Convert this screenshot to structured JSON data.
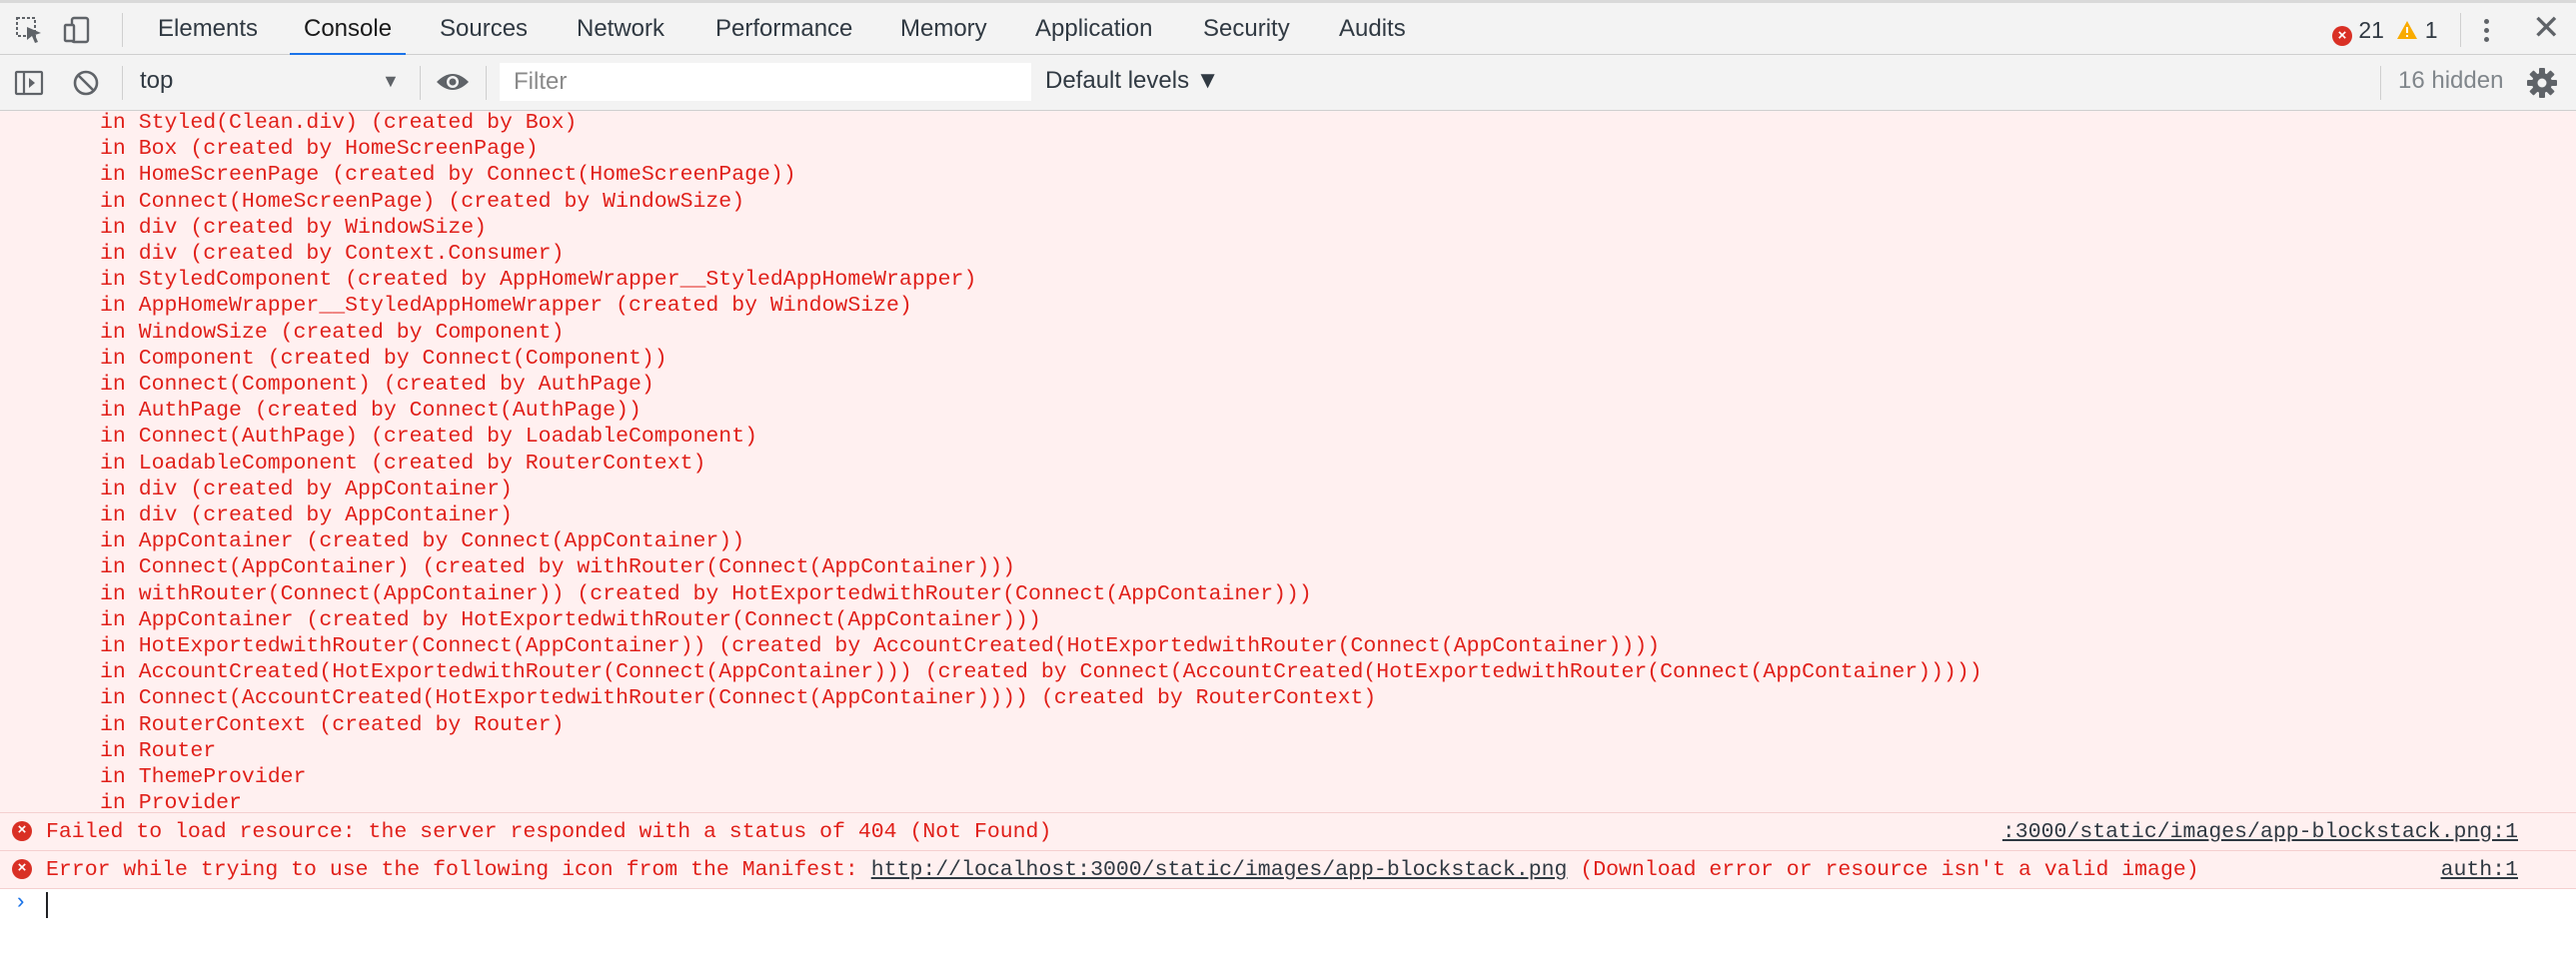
{
  "tabs": [
    "Elements",
    "Console",
    "Sources",
    "Network",
    "Performance",
    "Memory",
    "Application",
    "Security",
    "Audits"
  ],
  "active_tab": "Console",
  "counters": {
    "errors": "21",
    "warnings": "1"
  },
  "toolbar": {
    "context": "top",
    "filter_placeholder": "Filter",
    "levels": "Default levels ▼",
    "hidden": "16 hidden"
  },
  "stack_lines": [
    "in Styled(Clean.div) (created by Box)",
    "in Box (created by HomeScreenPage)",
    "in HomeScreenPage (created by Connect(HomeScreenPage))",
    "in Connect(HomeScreenPage) (created by WindowSize)",
    "in div (created by WindowSize)",
    "in div (created by Context.Consumer)",
    "in StyledComponent (created by AppHomeWrapper__StyledAppHomeWrapper)",
    "in AppHomeWrapper__StyledAppHomeWrapper (created by WindowSize)",
    "in WindowSize (created by Component)",
    "in Component (created by Connect(Component))",
    "in Connect(Component) (created by AuthPage)",
    "in AuthPage (created by Connect(AuthPage))",
    "in Connect(AuthPage) (created by LoadableComponent)",
    "in LoadableComponent (created by RouterContext)",
    "in div (created by AppContainer)",
    "in div (created by AppContainer)",
    "in AppContainer (created by Connect(AppContainer))",
    "in Connect(AppContainer) (created by withRouter(Connect(AppContainer)))",
    "in withRouter(Connect(AppContainer)) (created by HotExportedwithRouter(Connect(AppContainer)))",
    "in AppContainer (created by HotExportedwithRouter(Connect(AppContainer)))",
    "in HotExportedwithRouter(Connect(AppContainer)) (created by AccountCreated(HotExportedwithRouter(Connect(AppContainer))))",
    "in AccountCreated(HotExportedwithRouter(Connect(AppContainer))) (created by Connect(AccountCreated(HotExportedwithRouter(Connect(AppContainer)))))",
    "in Connect(AccountCreated(HotExportedwithRouter(Connect(AppContainer)))) (created by RouterContext)",
    "in RouterContext (created by Router)",
    "in Router",
    "in ThemeProvider",
    "in Provider"
  ],
  "messages": [
    {
      "text": "Failed to load resource: the server responded with a status of 404 (Not Found)",
      "link": "",
      "suffix": "",
      "source": ":3000/static/images/app-blockstack.png:1"
    },
    {
      "text": "Error while trying to use the following icon from the Manifest: ",
      "link": "http://localhost:3000/static/images/app-blockstack.png",
      "suffix": " (Download error or resource isn't a valid image)",
      "source": "auth:1"
    }
  ],
  "prompt_symbol": "›",
  "colors": {
    "error_text": "#e0201a",
    "error_bg": "#fff0f0",
    "accent": "#1a73e8"
  }
}
